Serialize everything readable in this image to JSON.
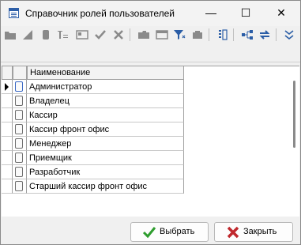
{
  "window": {
    "title": "Справочник ролей пользователей",
    "controls": {
      "minimize": "—",
      "maximize": "☐",
      "close": "✕"
    }
  },
  "toolbar": {
    "icons": [
      "folder-icon",
      "edit-pen-icon",
      "delete-icon",
      "edit-text-icon",
      "card-icon",
      "check-icon",
      "cancel-icon",
      "folder-open-icon",
      "window-icon",
      "filter-icon",
      "group-icon",
      "columns-icon",
      "tree-icon",
      "refresh-icon",
      "chevron-down-icon"
    ],
    "active_color": "#2a5da6",
    "disabled_color": "#8a8a8a"
  },
  "grid": {
    "column_header": "Наименование",
    "rows": [
      {
        "name": "Администратор",
        "selected": true
      },
      {
        "name": "Владелец",
        "selected": false
      },
      {
        "name": "Кассир",
        "selected": false
      },
      {
        "name": "Кассир фронт офис",
        "selected": false
      },
      {
        "name": "Менеджер",
        "selected": false
      },
      {
        "name": "Приемщик",
        "selected": false
      },
      {
        "name": "Разработчик",
        "selected": false
      },
      {
        "name": "Старший кассир фронт офис",
        "selected": false
      }
    ]
  },
  "buttons": {
    "ok_label": "Выбрать",
    "cancel_label": "Закрыть",
    "ok_color": "#2e9d2e",
    "cancel_color": "#c0282d"
  }
}
